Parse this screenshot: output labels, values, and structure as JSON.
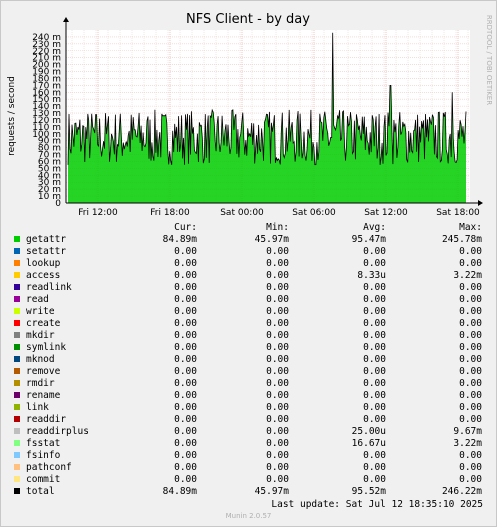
{
  "chart_data": {
    "type": "line",
    "title": "NFS Client - by day",
    "ylabel": "requests / second",
    "side_label": "RRDTOOL / TOBI OETIKER",
    "ylim": [
      0,
      250
    ],
    "y_ticks": [
      "0",
      "10 m",
      "20 m",
      "30 m",
      "40 m",
      "50 m",
      "60 m",
      "70 m",
      "80 m",
      "90 m",
      "100 m",
      "110 m",
      "120 m",
      "130 m",
      "140 m",
      "150 m",
      "160 m",
      "170 m",
      "180 m",
      "190 m",
      "200 m",
      "210 m",
      "220 m",
      "230 m",
      "240 m"
    ],
    "x_ticks": [
      "Fri 12:00",
      "Fri 18:00",
      "Sat 00:00",
      "Sat 06:00",
      "Sat 12:00",
      "Sat 18:00"
    ],
    "grid": true,
    "series": [
      {
        "name": "getattr",
        "color": "#00cc00",
        "avg": 95,
        "min": 46,
        "max": 246,
        "spikes": [
          {
            "x": 0.665,
            "y": 246
          },
          {
            "x": 0.81,
            "y": 170
          },
          {
            "x": 0.965,
            "y": 160
          }
        ]
      }
    ]
  },
  "legend": {
    "headers": {
      "cur": "Cur:",
      "min": "Min:",
      "avg": "Avg:",
      "max": "Max:"
    },
    "rows": [
      {
        "name": "getattr",
        "color": "#00cc00",
        "cur": "84.89m",
        "min": "45.97m",
        "avg": "95.47m",
        "max": "245.78m"
      },
      {
        "name": "setattr",
        "color": "#0066b3",
        "cur": "0.00",
        "min": "0.00",
        "avg": "0.00",
        "max": "0.00"
      },
      {
        "name": "lookup",
        "color": "#ff8000",
        "cur": "0.00",
        "min": "0.00",
        "avg": "0.00",
        "max": "0.00"
      },
      {
        "name": "access",
        "color": "#ffcc00",
        "cur": "0.00",
        "min": "0.00",
        "avg": "8.33u",
        "max": "3.22m"
      },
      {
        "name": "readlink",
        "color": "#330099",
        "cur": "0.00",
        "min": "0.00",
        "avg": "0.00",
        "max": "0.00"
      },
      {
        "name": "read",
        "color": "#990099",
        "cur": "0.00",
        "min": "0.00",
        "avg": "0.00",
        "max": "0.00"
      },
      {
        "name": "write",
        "color": "#ccff00",
        "cur": "0.00",
        "min": "0.00",
        "avg": "0.00",
        "max": "0.00"
      },
      {
        "name": "create",
        "color": "#ff0000",
        "cur": "0.00",
        "min": "0.00",
        "avg": "0.00",
        "max": "0.00"
      },
      {
        "name": "mkdir",
        "color": "#808080",
        "cur": "0.00",
        "min": "0.00",
        "avg": "0.00",
        "max": "0.00"
      },
      {
        "name": "symlink",
        "color": "#008f00",
        "cur": "0.00",
        "min": "0.00",
        "avg": "0.00",
        "max": "0.00"
      },
      {
        "name": "mknod",
        "color": "#00487d",
        "cur": "0.00",
        "min": "0.00",
        "avg": "0.00",
        "max": "0.00"
      },
      {
        "name": "remove",
        "color": "#b35a00",
        "cur": "0.00",
        "min": "0.00",
        "avg": "0.00",
        "max": "0.00"
      },
      {
        "name": "rmdir",
        "color": "#b38f00",
        "cur": "0.00",
        "min": "0.00",
        "avg": "0.00",
        "max": "0.00"
      },
      {
        "name": "rename",
        "color": "#6b006b",
        "cur": "0.00",
        "min": "0.00",
        "avg": "0.00",
        "max": "0.00"
      },
      {
        "name": "link",
        "color": "#8fb300",
        "cur": "0.00",
        "min": "0.00",
        "avg": "0.00",
        "max": "0.00"
      },
      {
        "name": "readdir",
        "color": "#b30000",
        "cur": "0.00",
        "min": "0.00",
        "avg": "0.00",
        "max": "0.00"
      },
      {
        "name": "readdirplus",
        "color": "#bebebe",
        "cur": "0.00",
        "min": "0.00",
        "avg": "25.00u",
        "max": "9.67m"
      },
      {
        "name": "fsstat",
        "color": "#80ff80",
        "cur": "0.00",
        "min": "0.00",
        "avg": "16.67u",
        "max": "3.22m"
      },
      {
        "name": "fsinfo",
        "color": "#80c9ff",
        "cur": "0.00",
        "min": "0.00",
        "avg": "0.00",
        "max": "0.00"
      },
      {
        "name": "pathconf",
        "color": "#ffc080",
        "cur": "0.00",
        "min": "0.00",
        "avg": "0.00",
        "max": "0.00"
      },
      {
        "name": "commit",
        "color": "#ffe680",
        "cur": "0.00",
        "min": "0.00",
        "avg": "0.00",
        "max": "0.00"
      },
      {
        "name": "total",
        "color": "#000000",
        "cur": "84.89m",
        "min": "45.97m",
        "avg": "95.52m",
        "max": "246.22m"
      }
    ]
  },
  "last_update": "Last update: Sat Jul 12 18:35:10 2025",
  "munin_version": "Munin 2.0.57"
}
